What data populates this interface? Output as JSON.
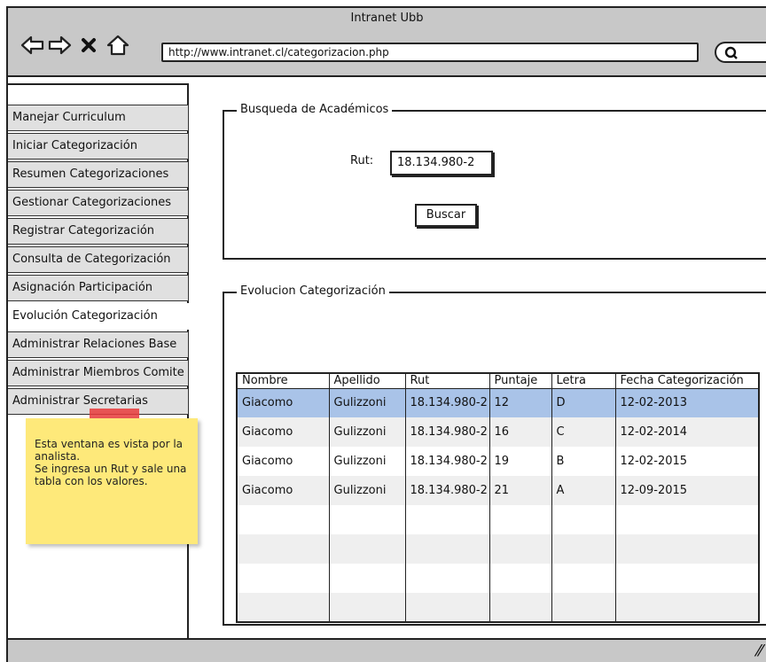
{
  "browser": {
    "title": "Intranet Ubb",
    "url": "http://www.intranet.cl/categorizacion.php",
    "icons": [
      "back-arrow-icon",
      "forward-arrow-icon",
      "close-icon",
      "home-icon",
      "search-icon"
    ]
  },
  "sidebar": {
    "items": [
      {
        "label": "Manejar Curriculum"
      },
      {
        "label": "Iniciar Categorización"
      },
      {
        "label": "Resumen Categorizaciones"
      },
      {
        "label": "Gestionar Categorizaciones"
      },
      {
        "label": "Registrar Categorización"
      },
      {
        "label": "Consulta de Categorización"
      },
      {
        "label": "Asignación Participación"
      },
      {
        "label": "Evolución Categorización"
      },
      {
        "label": "Administrar Relaciones Base"
      },
      {
        "label": "Administrar Miembros Comite"
      },
      {
        "label": "Administrar Secretarias"
      }
    ],
    "active_index": 7
  },
  "note": {
    "text_1": "Esta ventana es vista por la analista.",
    "text_2": "Se ingresa un Rut y sale una tabla con los valores.",
    "color": "#fee97a"
  },
  "search_panel": {
    "legend": "Busqueda de Académicos",
    "rut_label": "Rut:",
    "rut_value": "18.134.980-2",
    "button_label": "Buscar"
  },
  "results_panel": {
    "legend": "Evolucion Categorización",
    "columns": [
      "Nombre",
      "Apellido",
      "Rut",
      "Puntaje",
      "Letra",
      "Fecha Categorización"
    ],
    "rows": [
      [
        "Giacomo",
        "Gulizzoni",
        "18.134.980-2",
        "12",
        "D",
        "12-02-2013"
      ],
      [
        "Giacomo",
        "Gulizzoni",
        "18.134.980-2",
        "16",
        "C",
        "12-02-2014"
      ],
      [
        "Giacomo",
        "Gulizzoni",
        "18.134.980-2",
        "19",
        "B",
        "12-02-2015"
      ],
      [
        "Giacomo",
        "Gulizzoni",
        "18.134.980-2",
        "21",
        "A",
        "12-09-2015"
      ],
      [
        "",
        "",
        "",
        "",
        "",
        ""
      ],
      [
        "",
        "",
        "",
        "",
        "",
        ""
      ],
      [
        "",
        "",
        "",
        "",
        "",
        ""
      ],
      [
        "",
        "",
        "",
        "",
        "",
        ""
      ]
    ],
    "selected_row": 0,
    "selection_color": "#a9c3e8"
  }
}
